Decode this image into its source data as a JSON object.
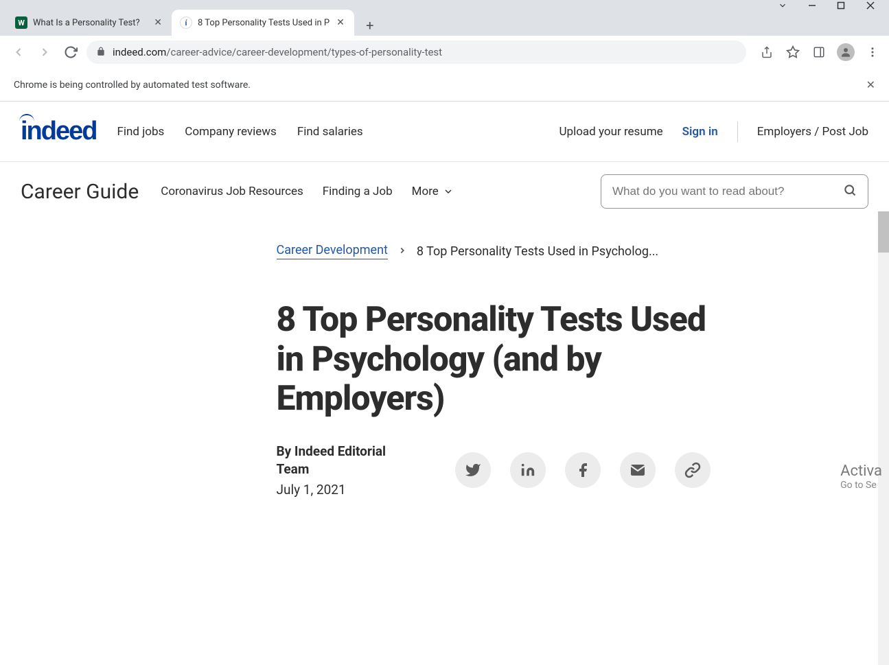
{
  "window": {
    "tabs": [
      {
        "title": "What Is a Personality Test?",
        "favicon_bg": "#0a5f3c",
        "favicon_text": "W",
        "favicon_color": "#fff"
      },
      {
        "title": "8 Top Personality Tests Used in P",
        "favicon_bg": "#fff",
        "favicon_text": "i",
        "favicon_color": "#2557a7"
      }
    ],
    "url_domain": "indeed.com",
    "url_path": "/career-advice/career-development/types-of-personality-test",
    "info_message": "Chrome is being controlled by automated test software."
  },
  "header": {
    "brand": "indeed",
    "nav": [
      "Find jobs",
      "Company reviews",
      "Find salaries"
    ],
    "upload": "Upload your resume",
    "signin": "Sign in",
    "employers": "Employers / Post Job"
  },
  "subnav": {
    "title": "Career Guide",
    "items": [
      "Coronavirus Job Resources",
      "Finding a Job",
      "More"
    ],
    "search_placeholder": "What do you want to read about?"
  },
  "breadcrumb": {
    "link": "Career Development",
    "current": "8 Top Personality Tests Used in Psycholog..."
  },
  "article": {
    "title": "8 Top Personality Tests Used in Psychology (and by Employers)",
    "author": "By Indeed Editorial Team",
    "date": "July 1, 2021"
  },
  "watermark": {
    "line1": "Activa",
    "line2": "Go to Se"
  }
}
